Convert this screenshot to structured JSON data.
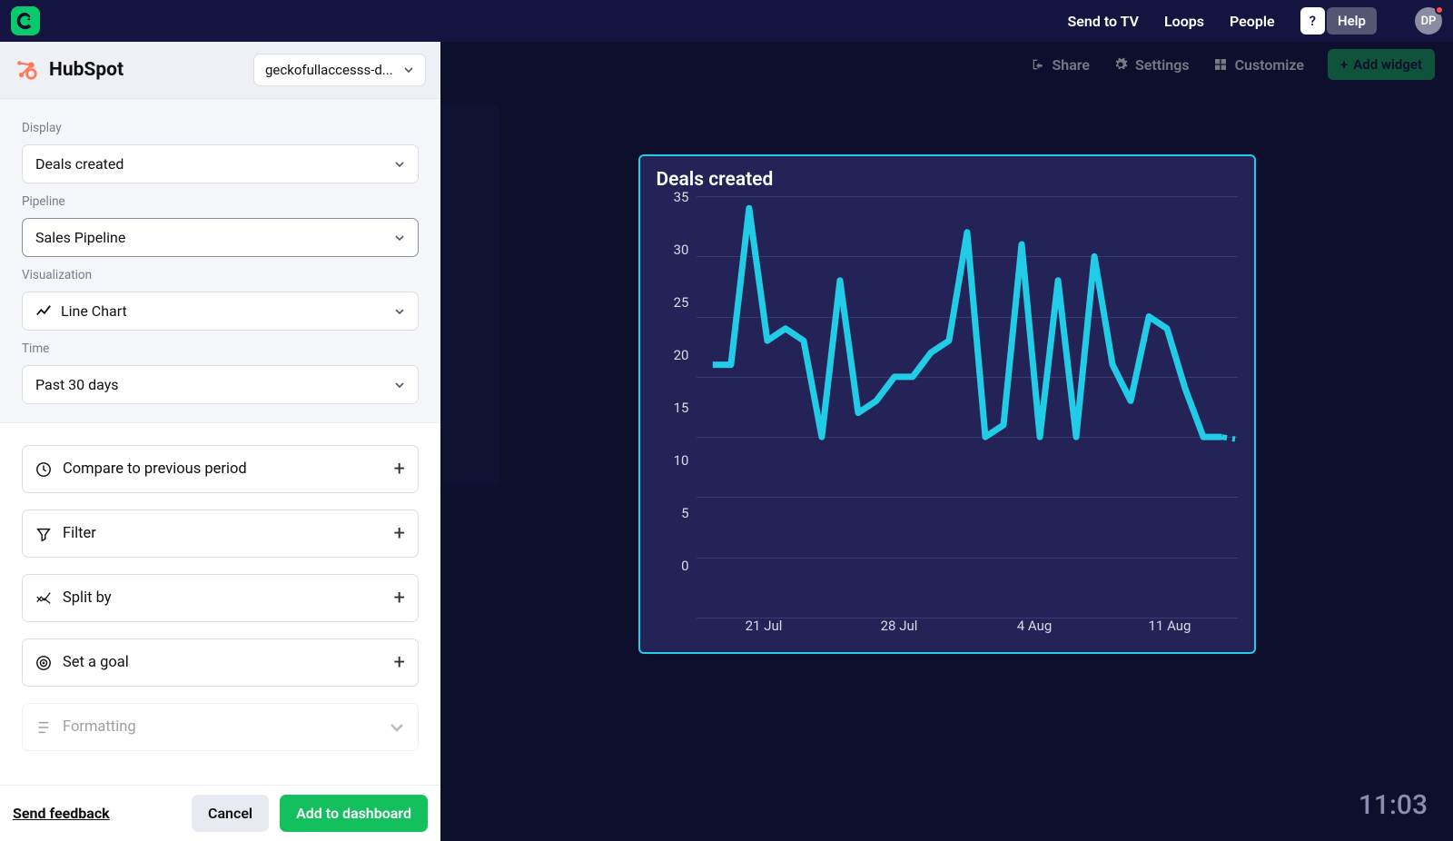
{
  "header": {
    "nav": {
      "send_tv": "Send to TV",
      "loops": "Loops",
      "people": "People"
    },
    "help_q": "?",
    "help": "Help",
    "avatar": "DP"
  },
  "dash": {
    "share": "Share",
    "settings": "Settings",
    "customize": "Customize",
    "add_widget": "Add widget"
  },
  "panel": {
    "title": "HubSpot",
    "connection": "geckofullaccesss-d...",
    "form": {
      "display_label": "Display",
      "display_value": "Deals created",
      "pipeline_label": "Pipeline",
      "pipeline_value": "Sales Pipeline",
      "viz_label": "Visualization",
      "viz_value": "Line Chart",
      "time_label": "Time",
      "time_value": "Past 30 days"
    },
    "options": {
      "compare": "Compare to previous period",
      "filter": "Filter",
      "split": "Split by",
      "goal": "Set a goal",
      "formatting": "Formatting"
    },
    "footer": {
      "feedback": "Send feedback",
      "cancel": "Cancel",
      "add": "Add to dashboard"
    }
  },
  "preview": {
    "title": "Deals created",
    "clock": "11:03"
  },
  "chart_data": {
    "type": "line",
    "title": "Deals created",
    "xlabel": "",
    "ylabel": "",
    "ylim": [
      0,
      35
    ],
    "y_ticks": [
      35,
      30,
      25,
      20,
      15,
      10,
      5,
      0
    ],
    "x_tick_labels": [
      "21 Jul",
      "28 Jul",
      "4 Aug",
      "11 Aug"
    ],
    "series": [
      {
        "name": "Deals created",
        "color": "#22cbe6",
        "values": [
          21,
          21,
          34,
          23,
          24,
          23,
          15,
          28,
          17,
          18,
          20,
          20,
          22,
          23,
          32,
          15,
          16,
          31,
          15,
          28,
          15,
          30,
          21,
          18,
          25,
          24,
          19,
          15,
          15
        ]
      }
    ]
  }
}
